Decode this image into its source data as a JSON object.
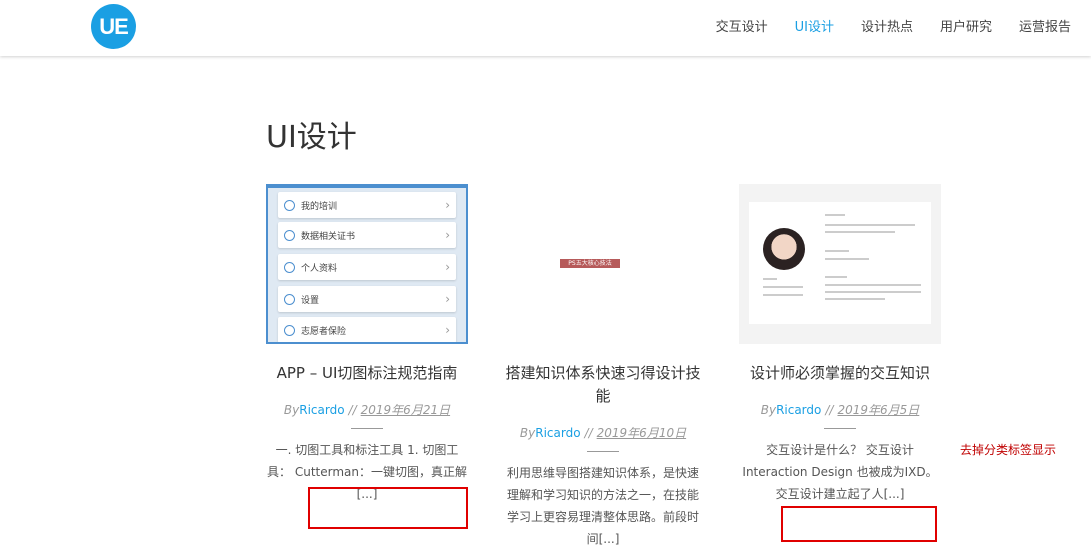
{
  "header": {
    "logo_text": "UE",
    "nav": [
      {
        "label": "交互设计",
        "active": false
      },
      {
        "label": "UI设计",
        "active": true
      },
      {
        "label": "设计热点",
        "active": false
      },
      {
        "label": "用户研究",
        "active": false
      },
      {
        "label": "运营报告",
        "active": false
      }
    ]
  },
  "page": {
    "title": "UI设计"
  },
  "posts": [
    {
      "title": "APP – UI切图标注规范指南",
      "by": "By",
      "author": "Ricardo",
      "sep": "//",
      "date": "2019年6月21日",
      "excerpt": "一. 切图工具和标注工具 1. 切图工具： Cutterman：一键切图，真正解",
      "more": "[...]",
      "thumb_rows": [
        "我的培训",
        "数据相关证书",
        "个人资料",
        "设置",
        "志愿者保险"
      ]
    },
    {
      "title": "搭建知识体系快速习得设计技能",
      "by": "By",
      "author": "Ricardo",
      "sep": "//",
      "date": "2019年6月10日",
      "excerpt": "利用思维导图搭建知识体系，是快速理解和学习知识的方法之一，在技能学习上更容易理清整体思路。前段时间",
      "more": "[...]",
      "thumb_tag": "PS五大核心技法"
    },
    {
      "title": "设计师必须掌握的交互知识",
      "by": "By",
      "author": "Ricardo",
      "sep": "//",
      "date": "2019年6月5日",
      "excerpt": "交互设计是什么？ 交互设计 Interaction Design 也被成为IXD。交互设计建立起了人",
      "more": "[...]"
    }
  ],
  "annotation": {
    "note": "去掉分类标签显示",
    "color": "#c00000"
  },
  "colors": {
    "accent": "#1a9fe3",
    "annotation_box": "#e00000"
  }
}
